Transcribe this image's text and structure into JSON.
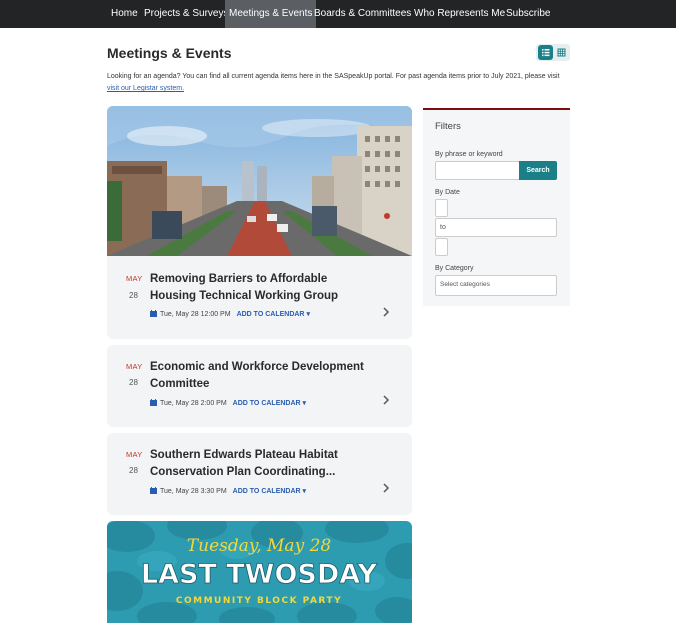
{
  "nav": {
    "items": [
      "Home",
      "Projects & Surveys",
      "Meetings & Events",
      "Boards & Committees",
      "Who Represents Me",
      "Subscribe"
    ]
  },
  "page": {
    "title": "Meetings & Events",
    "intro_text": "Looking for an agenda? You can find all current agenda items here in the SASpeakUp portal. For past agenda items prior to July 2021, please visit",
    "intro_link": "visit our Legistar system."
  },
  "events": [
    {
      "month": "MAY",
      "day": "28",
      "title": "Removing Barriers to Affordable Housing Technical Working Group",
      "datetime": "Tue, May 28 12:00 PM",
      "add_label": "ADD TO CALENDAR"
    },
    {
      "month": "MAY",
      "day": "28",
      "title": "Economic and Workforce Development Committee",
      "datetime": "Tue, May 28 2:00 PM",
      "add_label": "ADD TO CALENDAR"
    },
    {
      "month": "MAY",
      "day": "28",
      "title": "Southern Edwards Plateau Habitat Conservation Plan Coordinating...",
      "datetime": "Tue, May 28 3:30 PM",
      "add_label": "ADD TO CALENDAR"
    }
  ],
  "promo": {
    "script_line": "Tuesday, May 28",
    "headline": "LAST TWOSDAY",
    "subline": "COMMUNITY BLOCK PARTY"
  },
  "filters": {
    "title": "Filters",
    "phrase_label": "By phrase or keyword",
    "phrase_value": "",
    "search_label": "Search",
    "date_label": "By Date",
    "date_to": "to",
    "category_label": "By Category",
    "category_placeholder": "Select categories"
  },
  "colors": {
    "nav_bg": "#222426",
    "nav_active": "#5b5e63",
    "accent": "#1a7f87",
    "month_red": "#c0392b",
    "link_blue": "#2a5db0",
    "filter_border": "#7b1010",
    "card_bg": "#f2f4f6"
  }
}
